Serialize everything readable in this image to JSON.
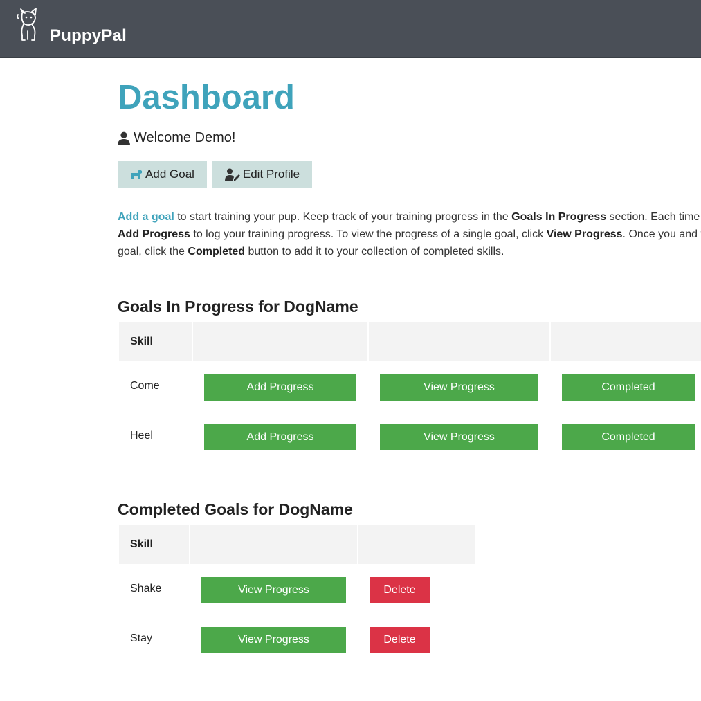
{
  "app": {
    "brand": "PuppyPal"
  },
  "page": {
    "title": "Dashboard",
    "welcome": "Welcome Demo!"
  },
  "actions": {
    "add_goal": "Add Goal",
    "edit_profile": "Edit Profile"
  },
  "intro": {
    "link": "Add a goal",
    "t1": " to start training your pup. Keep track of your training progress in the ",
    "b1": "Goals In Progress",
    "t2": " section. Each time",
    "b2": "Add Progress",
    "t3": " to log your training progress. To view the progress of a single goal, click ",
    "b3": "View Progress",
    "t4": ". Once you and y",
    "t5": "goal, click the ",
    "b4": "Completed",
    "t6": " button to add it to your collection of completed skills."
  },
  "in_progress": {
    "title": "Goals In Progress for DogName",
    "header": "Skill",
    "rows": [
      {
        "skill": "Come",
        "add": "Add Progress",
        "view": "View Progress",
        "complete": "Completed"
      },
      {
        "skill": "Heel",
        "add": "Add Progress",
        "view": "View Progress",
        "complete": "Completed"
      }
    ]
  },
  "completed": {
    "title": "Completed Goals for DogName",
    "header": "Skill",
    "rows": [
      {
        "skill": "Shake",
        "view": "View Progress",
        "delete": "Delete"
      },
      {
        "skill": "Stay",
        "view": "View Progress",
        "delete": "Delete"
      }
    ]
  },
  "colors": {
    "nav": "#4a4f57",
    "accent": "#3fa3bb",
    "success": "#4ca84a",
    "danger": "#db3346",
    "secondary": "#ccdfdd"
  },
  "icons": {
    "logo": "dog-logo-icon",
    "user": "user-icon",
    "add_goal": "dog-icon",
    "edit_profile": "user-edit-icon"
  }
}
